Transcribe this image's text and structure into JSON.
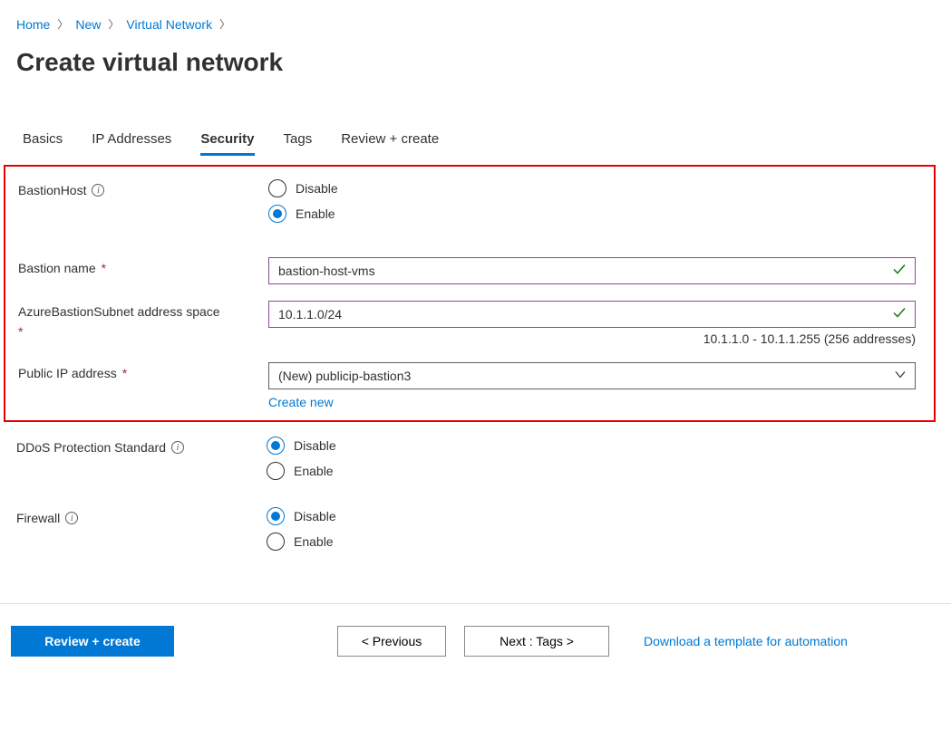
{
  "breadcrumb": {
    "items": [
      {
        "text": "Home"
      },
      {
        "text": "New"
      },
      {
        "text": "Virtual Network"
      }
    ]
  },
  "page": {
    "title": "Create virtual network"
  },
  "tabs": [
    {
      "label": "Basics",
      "active": false
    },
    {
      "label": "IP Addresses",
      "active": false
    },
    {
      "label": "Security",
      "active": true
    },
    {
      "label": "Tags",
      "active": false
    },
    {
      "label": "Review + create",
      "active": false
    }
  ],
  "security": {
    "bastion_host": {
      "label": "BastionHost",
      "options": {
        "disable": "Disable",
        "enable": "Enable"
      },
      "value": "enable"
    },
    "bastion_name": {
      "label": "Bastion name",
      "value": "bastion-host-vms"
    },
    "bastion_subnet": {
      "label": "AzureBastionSubnet address space",
      "value": "10.1.1.0/24",
      "helper": "10.1.1.0 - 10.1.1.255 (256 addresses)"
    },
    "public_ip": {
      "label": "Public IP address",
      "selected": "(New) publicip-bastion3",
      "create_new": "Create new"
    },
    "ddos": {
      "label": "DDoS Protection Standard",
      "options": {
        "disable": "Disable",
        "enable": "Enable"
      },
      "value": "disable"
    },
    "firewall": {
      "label": "Firewall",
      "options": {
        "disable": "Disable",
        "enable": "Enable"
      },
      "value": "disable"
    }
  },
  "footer": {
    "review": "Review + create",
    "previous": "<  Previous",
    "next": "Next : Tags  >",
    "download": "Download a template for automation"
  }
}
